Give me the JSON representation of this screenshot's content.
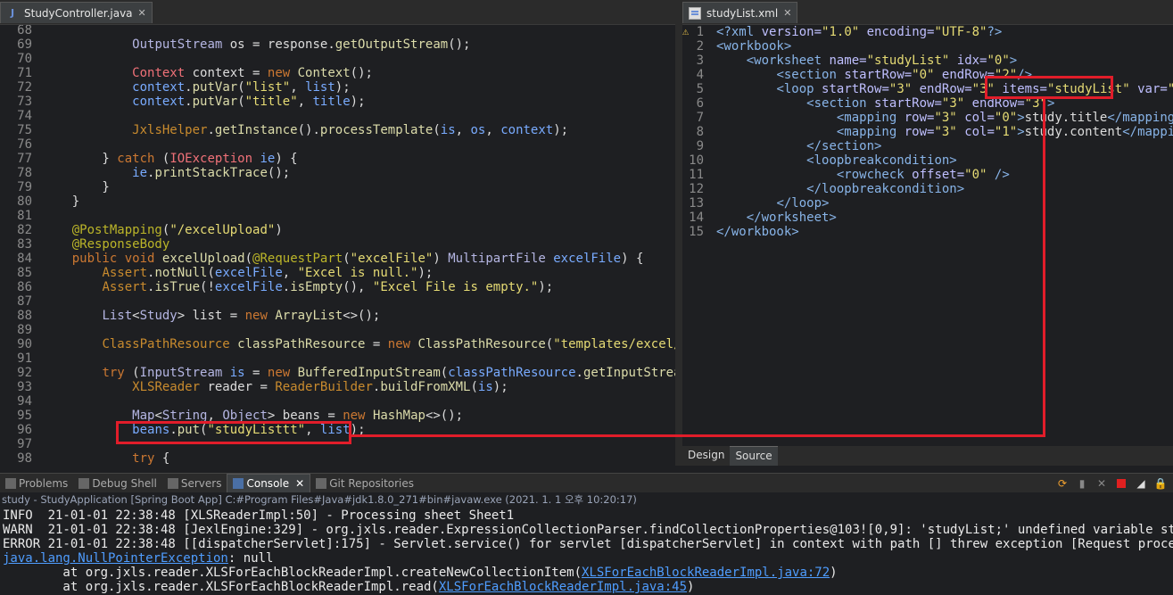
{
  "left_tab": {
    "title": "StudyController.java",
    "close": "✕"
  },
  "right_tab": {
    "title": "studyList.xml",
    "close": "✕"
  },
  "java": {
    "line_numbers": [
      "68",
      "69",
      "70",
      "71",
      "72",
      "73",
      "74",
      "75",
      "76",
      "77",
      "78",
      "79",
      "80",
      "81",
      "82",
      "83",
      "84",
      "85",
      "86",
      "87",
      "88",
      "89",
      "90",
      "91",
      "92",
      "93",
      "94",
      "95",
      "96",
      "97",
      "98"
    ],
    "lines": [
      [],
      [
        {
          "t": "            "
        },
        {
          "t": "OutputStream",
          "c": "ty"
        },
        {
          "t": " os = response."
        },
        {
          "t": "getOutputStream",
          "c": "fn"
        },
        {
          "t": "();"
        }
      ],
      [],
      [
        {
          "t": "            "
        },
        {
          "t": "Context",
          "c": "ex"
        },
        {
          "t": " context = "
        },
        {
          "t": "new",
          "c": "kw"
        },
        {
          "t": " "
        },
        {
          "t": "Context",
          "c": "fn"
        },
        {
          "t": "();"
        }
      ],
      [
        {
          "t": "            "
        },
        {
          "t": "context",
          "c": "va"
        },
        {
          "t": "."
        },
        {
          "t": "putVar",
          "c": "fn"
        },
        {
          "t": "("
        },
        {
          "t": "\"list\"",
          "c": "st"
        },
        {
          "t": ", "
        },
        {
          "t": "list",
          "c": "va"
        },
        {
          "t": ");"
        }
      ],
      [
        {
          "t": "            "
        },
        {
          "t": "context",
          "c": "va"
        },
        {
          "t": "."
        },
        {
          "t": "putVar",
          "c": "fn"
        },
        {
          "t": "("
        },
        {
          "t": "\"title\"",
          "c": "st"
        },
        {
          "t": ", "
        },
        {
          "t": "title",
          "c": "va"
        },
        {
          "t": ");"
        }
      ],
      [],
      [
        {
          "t": "            "
        },
        {
          "t": "JxlsHelper",
          "c": "cl"
        },
        {
          "t": "."
        },
        {
          "t": "getInstance",
          "c": "fn"
        },
        {
          "t": "()."
        },
        {
          "t": "processTemplate",
          "c": "fn"
        },
        {
          "t": "("
        },
        {
          "t": "is",
          "c": "va"
        },
        {
          "t": ", "
        },
        {
          "t": "os",
          "c": "va"
        },
        {
          "t": ", "
        },
        {
          "t": "context",
          "c": "va"
        },
        {
          "t": ");"
        }
      ],
      [],
      [
        {
          "t": "        } "
        },
        {
          "t": "catch",
          "c": "kw"
        },
        {
          "t": " ("
        },
        {
          "t": "IOException",
          "c": "ex"
        },
        {
          "t": " "
        },
        {
          "t": "ie",
          "c": "va"
        },
        {
          "t": ") {"
        }
      ],
      [
        {
          "t": "            "
        },
        {
          "t": "ie",
          "c": "va"
        },
        {
          "t": "."
        },
        {
          "t": "printStackTrace",
          "c": "fn"
        },
        {
          "t": "();"
        }
      ],
      [
        {
          "t": "        }"
        }
      ],
      [
        {
          "t": "    }"
        }
      ],
      [],
      [
        {
          "t": "    "
        },
        {
          "t": "@PostMapping",
          "c": "an"
        },
        {
          "t": "("
        },
        {
          "t": "\"/excelUpload\"",
          "c": "st"
        },
        {
          "t": ")"
        }
      ],
      [
        {
          "t": "    "
        },
        {
          "t": "@ResponseBody",
          "c": "an"
        }
      ],
      [
        {
          "t": "    "
        },
        {
          "t": "public",
          "c": "kw"
        },
        {
          "t": " "
        },
        {
          "t": "void",
          "c": "kw"
        },
        {
          "t": " "
        },
        {
          "t": "excelUpload",
          "c": "fn"
        },
        {
          "t": "("
        },
        {
          "t": "@RequestPart",
          "c": "an"
        },
        {
          "t": "("
        },
        {
          "t": "\"excelFile\"",
          "c": "st"
        },
        {
          "t": ") "
        },
        {
          "t": "MultipartFile",
          "c": "ty"
        },
        {
          "t": " "
        },
        {
          "t": "excelFile",
          "c": "va"
        },
        {
          "t": ") {"
        }
      ],
      [
        {
          "t": "        "
        },
        {
          "t": "Assert",
          "c": "cl"
        },
        {
          "t": "."
        },
        {
          "t": "notNull",
          "c": "fn"
        },
        {
          "t": "("
        },
        {
          "t": "excelFile",
          "c": "va"
        },
        {
          "t": ", "
        },
        {
          "t": "\"Excel is null.\"",
          "c": "st"
        },
        {
          "t": ");"
        }
      ],
      [
        {
          "t": "        "
        },
        {
          "t": "Assert",
          "c": "cl"
        },
        {
          "t": "."
        },
        {
          "t": "isTrue",
          "c": "fn"
        },
        {
          "t": "(!"
        },
        {
          "t": "excelFile",
          "c": "va"
        },
        {
          "t": "."
        },
        {
          "t": "isEmpty",
          "c": "fn"
        },
        {
          "t": "(), "
        },
        {
          "t": "\"Excel File is empty.\"",
          "c": "st"
        },
        {
          "t": ");"
        }
      ],
      [],
      [
        {
          "t": "        "
        },
        {
          "t": "List",
          "c": "ty"
        },
        {
          "t": "<"
        },
        {
          "t": "Study",
          "c": "ty"
        },
        {
          "t": "> list = "
        },
        {
          "t": "new",
          "c": "kw"
        },
        {
          "t": " "
        },
        {
          "t": "ArrayList",
          "c": "fn"
        },
        {
          "t": "<>();"
        }
      ],
      [],
      [
        {
          "t": "        "
        },
        {
          "t": "ClassPathResource",
          "c": "cl"
        },
        {
          "t": " "
        },
        {
          "t": "classPathResource",
          "c": "fn"
        },
        {
          "t": " = "
        },
        {
          "t": "new",
          "c": "kw"
        },
        {
          "t": " "
        },
        {
          "t": "ClassPathResource",
          "c": "fn"
        },
        {
          "t": "("
        },
        {
          "t": "\"templates/excel/st",
          "c": "st"
        }
      ],
      [],
      [
        {
          "t": "        "
        },
        {
          "t": "try",
          "c": "kw"
        },
        {
          "t": " ("
        },
        {
          "t": "InputStream",
          "c": "ty"
        },
        {
          "t": " "
        },
        {
          "t": "is",
          "c": "va"
        },
        {
          "t": " = "
        },
        {
          "t": "new",
          "c": "kw"
        },
        {
          "t": " "
        },
        {
          "t": "BufferedInputStream",
          "c": "fn"
        },
        {
          "t": "("
        },
        {
          "t": "classPathResource",
          "c": "va"
        },
        {
          "t": "."
        },
        {
          "t": "getInputStream",
          "c": "fn"
        },
        {
          "t": "("
        }
      ],
      [
        {
          "t": "            "
        },
        {
          "t": "XLSReader",
          "c": "cl"
        },
        {
          "t": " reader = "
        },
        {
          "t": "ReaderBuilder",
          "c": "cl"
        },
        {
          "t": "."
        },
        {
          "t": "buildFromXML",
          "c": "fn"
        },
        {
          "t": "("
        },
        {
          "t": "is",
          "c": "va"
        },
        {
          "t": ");"
        }
      ],
      [],
      [
        {
          "t": "            "
        },
        {
          "t": "Map",
          "c": "ty"
        },
        {
          "t": "<"
        },
        {
          "t": "String",
          "c": "ty"
        },
        {
          "t": ", "
        },
        {
          "t": "Object",
          "c": "ty"
        },
        {
          "t": "> beans = "
        },
        {
          "t": "new",
          "c": "kw"
        },
        {
          "t": " "
        },
        {
          "t": "HashMap",
          "c": "fn"
        },
        {
          "t": "<>();"
        }
      ],
      [
        {
          "t": "            "
        },
        {
          "t": "beans",
          "c": "va"
        },
        {
          "t": "."
        },
        {
          "t": "put",
          "c": "fn"
        },
        {
          "t": "("
        },
        {
          "t": "\"studyListtt\"",
          "c": "st"
        },
        {
          "t": ", "
        },
        {
          "t": "list",
          "c": "va"
        },
        {
          "t": ");"
        }
      ],
      [],
      [
        {
          "t": "            "
        },
        {
          "t": "try",
          "c": "kw"
        },
        {
          "t": " {"
        }
      ]
    ]
  },
  "xml": {
    "line_numbers": [
      "1",
      "2",
      "3",
      "4",
      "5",
      "6",
      "7",
      "8",
      "9",
      "10",
      "11",
      "12",
      "13",
      "14",
      "15"
    ],
    "lines": [
      [
        {
          "t": "<?",
          "c": "pi"
        },
        {
          "t": "xml",
          "c": "pi"
        },
        {
          "t": " "
        },
        {
          "t": "version=",
          "c": "at"
        },
        {
          "t": "\"1.0\"",
          "c": "av"
        },
        {
          "t": " "
        },
        {
          "t": "encoding=",
          "c": "at"
        },
        {
          "t": "\"UTF-8\"",
          "c": "av"
        },
        {
          "t": "?>",
          "c": "pi"
        }
      ],
      [
        {
          "t": "<workbook>",
          "c": "tag"
        }
      ],
      [
        {
          "t": "    "
        },
        {
          "t": "<worksheet",
          "c": "tag"
        },
        {
          "t": " "
        },
        {
          "t": "name=",
          "c": "at"
        },
        {
          "t": "\"studyList\"",
          "c": "av"
        },
        {
          "t": " "
        },
        {
          "t": "idx=",
          "c": "at"
        },
        {
          "t": "\"0\"",
          "c": "av"
        },
        {
          "t": ">",
          "c": "tag"
        }
      ],
      [
        {
          "t": "        "
        },
        {
          "t": "<section",
          "c": "tag"
        },
        {
          "t": " "
        },
        {
          "t": "startRow=",
          "c": "at"
        },
        {
          "t": "\"0\"",
          "c": "av"
        },
        {
          "t": " "
        },
        {
          "t": "endRow=",
          "c": "at"
        },
        {
          "t": "\"2\"",
          "c": "av"
        },
        {
          "t": "/>",
          "c": "tag"
        }
      ],
      [
        {
          "t": "        "
        },
        {
          "t": "<loop",
          "c": "tag"
        },
        {
          "t": " "
        },
        {
          "t": "startRow=",
          "c": "at"
        },
        {
          "t": "\"3\"",
          "c": "av"
        },
        {
          "t": " "
        },
        {
          "t": "endRow=",
          "c": "at"
        },
        {
          "t": "\"3\"",
          "c": "av"
        },
        {
          "t": " "
        },
        {
          "t": "items=",
          "c": "at"
        },
        {
          "t": "\"studyList\"",
          "c": "av"
        },
        {
          "t": " "
        },
        {
          "t": "var=",
          "c": "at"
        },
        {
          "t": "\"stu",
          "c": "av"
        }
      ],
      [
        {
          "t": "            "
        },
        {
          "t": "<section",
          "c": "tag"
        },
        {
          "t": " "
        },
        {
          "t": "startRow=",
          "c": "at"
        },
        {
          "t": "\"3\"",
          "c": "av"
        },
        {
          "t": " "
        },
        {
          "t": "endRow=",
          "c": "at"
        },
        {
          "t": "\"3\"",
          "c": "av"
        },
        {
          "t": ">",
          "c": "tag"
        }
      ],
      [
        {
          "t": "                "
        },
        {
          "t": "<mapping",
          "c": "tag"
        },
        {
          "t": " "
        },
        {
          "t": "row=",
          "c": "at"
        },
        {
          "t": "\"3\"",
          "c": "av"
        },
        {
          "t": " "
        },
        {
          "t": "col=",
          "c": "at"
        },
        {
          "t": "\"0\"",
          "c": "av"
        },
        {
          "t": ">",
          "c": "tag"
        },
        {
          "t": "study.title"
        },
        {
          "t": "</mapping>",
          "c": "tag"
        }
      ],
      [
        {
          "t": "                "
        },
        {
          "t": "<mapping",
          "c": "tag"
        },
        {
          "t": " "
        },
        {
          "t": "row=",
          "c": "at"
        },
        {
          "t": "\"3\"",
          "c": "av"
        },
        {
          "t": " "
        },
        {
          "t": "col=",
          "c": "at"
        },
        {
          "t": "\"1\"",
          "c": "av"
        },
        {
          "t": ">",
          "c": "tag"
        },
        {
          "t": "study.content"
        },
        {
          "t": "</mapping>",
          "c": "tag"
        }
      ],
      [
        {
          "t": "            "
        },
        {
          "t": "</section>",
          "c": "tag"
        }
      ],
      [
        {
          "t": "            "
        },
        {
          "t": "<loopbreakcondition>",
          "c": "tag"
        }
      ],
      [
        {
          "t": "                "
        },
        {
          "t": "<rowcheck",
          "c": "tag"
        },
        {
          "t": " "
        },
        {
          "t": "offset=",
          "c": "at"
        },
        {
          "t": "\"0\"",
          "c": "av"
        },
        {
          "t": " "
        },
        {
          "t": "/>",
          "c": "tag"
        }
      ],
      [
        {
          "t": "            "
        },
        {
          "t": "</loopbreakcondition>",
          "c": "tag"
        }
      ],
      [
        {
          "t": "        "
        },
        {
          "t": "</loop>",
          "c": "tag"
        }
      ],
      [
        {
          "t": "    "
        },
        {
          "t": "</worksheet>",
          "c": "tag"
        }
      ],
      [
        {
          "t": "</workbook>",
          "c": "tag"
        }
      ]
    ]
  },
  "editor_tabs": {
    "design": "Design",
    "source": "Source"
  },
  "console_tabs": [
    {
      "label": "Problems",
      "icon": "problems-icon",
      "active": false
    },
    {
      "label": "Debug Shell",
      "icon": "debug-shell-icon",
      "active": false
    },
    {
      "label": "Servers",
      "icon": "servers-icon",
      "active": false
    },
    {
      "label": "Console",
      "icon": "console-icon",
      "active": true,
      "close": "✕"
    },
    {
      "label": "Git Repositories",
      "icon": "git-icon",
      "active": false
    }
  ],
  "console_header": "study - StudyApplication [Spring Boot App] C:#Program Files#Java#jdk1.8.0_271#bin#javaw.exe  (2021. 1. 1 오후 10:20:17)",
  "console_lines": [
    [
      {
        "t": "INFO  21-01-01 22:38:48 [XLSReaderImpl:50] - Processing sheet Sheet1"
      }
    ],
    [
      {
        "t": "WARN  21-01-01 22:38:48 [JexlEngine:329] - org.jxls.reader.ExpressionCollectionParser.findCollectionProperties@103![0,9]: 'studyList;' undefined variable studyList"
      }
    ],
    [
      {
        "t": "ERROR 21-01-01 22:38:48 [[dispatcherServlet]:175] - Servlet.service() for servlet [dispatcherServlet] in context with path [] threw exception [Request processing fa"
      }
    ],
    [
      {
        "t": "java.lang.NullPointerException",
        "c": "link"
      },
      {
        "t": ": null"
      }
    ],
    [
      {
        "t": "        at org.jxls.reader.XLSForEachBlockReaderImpl.createNewCollectionItem("
      },
      {
        "t": "XLSForEachBlockReaderImpl.java:72",
        "c": "link"
      },
      {
        "t": ")"
      }
    ],
    [
      {
        "t": "        at org.jxls.reader.XLSForEachBlockReaderImpl.read("
      },
      {
        "t": "XLSForEachBlockReaderImpl.java:45",
        "c": "link"
      },
      {
        "t": ")"
      }
    ]
  ]
}
